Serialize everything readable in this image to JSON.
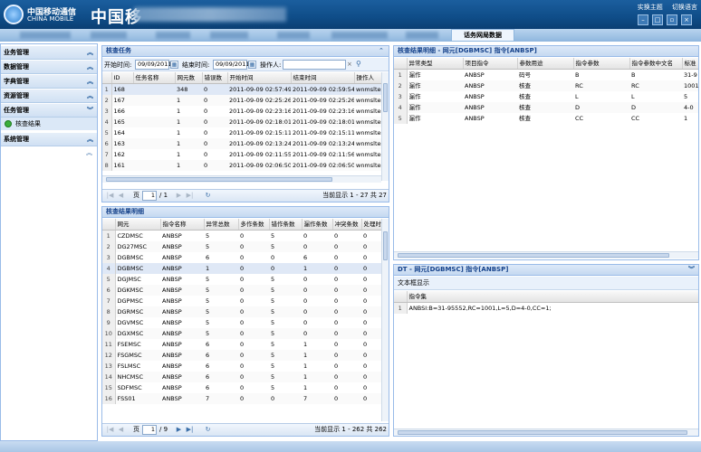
{
  "header": {
    "logo_cn": "中国移动通信",
    "logo_en": "CHINA MOBILE",
    "app_title": "中国移",
    "links": [
      "实换主题",
      "切换语言"
    ]
  },
  "nav": {
    "active_tab": "话务网局数据"
  },
  "sidebar": {
    "sections": [
      {
        "label": "业务管理"
      },
      {
        "label": "数据管理"
      },
      {
        "label": "字典管理"
      },
      {
        "label": "资源管理"
      },
      {
        "label": "任务管理"
      }
    ],
    "sub_item": "核查结果",
    "last_section": "系统管理"
  },
  "task_panel": {
    "title": "核查任务",
    "start_label": "开始时间:",
    "start_value": "09/09/2011",
    "end_label": "结束时间:",
    "end_value": "09/09/2011",
    "operator_label": "操作人:",
    "operator_value": "",
    "columns": [
      "",
      "ID",
      "任务名称",
      "网元数",
      "错误数",
      "开始时间",
      "结束时间",
      "操作人"
    ],
    "rows": [
      [
        "1",
        "168",
        "",
        "348",
        "0",
        "2011-09-09 02:57:49",
        "2011-09-09 02:59:54",
        "wnmsltes"
      ],
      [
        "2",
        "167",
        "",
        "1",
        "0",
        "2011-09-09 02:25:26",
        "2011-09-09 02:25:26",
        "wnmsltes"
      ],
      [
        "3",
        "166",
        "",
        "1",
        "0",
        "2011-09-09 02:23:16",
        "2011-09-09 02:23:16",
        "wnmsltes"
      ],
      [
        "4",
        "165",
        "",
        "1",
        "0",
        "2011-09-09 02:18:01",
        "2011-09-09 02:18:01",
        "wnmsltes"
      ],
      [
        "5",
        "164",
        "",
        "1",
        "0",
        "2011-09-09 02:15:11",
        "2011-09-09 02:15:11",
        "wnmsltes"
      ],
      [
        "6",
        "163",
        "",
        "1",
        "0",
        "2011-09-09 02:13:24",
        "2011-09-09 02:13:24",
        "wnmsltes"
      ],
      [
        "7",
        "162",
        "",
        "1",
        "0",
        "2011-09-09 02:11:55",
        "2011-09-09 02:11:56",
        "wnmsltes"
      ],
      [
        "8",
        "161",
        "",
        "1",
        "0",
        "2011-09-09 02:06:50",
        "2011-09-09 02:06:50",
        "wnmsltes"
      ]
    ],
    "pager": {
      "page_label": "页",
      "page": "1",
      "of": "/ 1",
      "info": "当前显示 1 - 27 共 27"
    }
  },
  "result_panel": {
    "title": "核查结果明细",
    "columns": [
      "",
      "网元",
      "指令名称",
      "异常总数",
      "多作条数",
      "错作条数",
      "漏作条数",
      "冲突条数",
      "处理时间"
    ],
    "rows": [
      [
        "1",
        "CZDMSC",
        "ANBSP",
        "5",
        "0",
        "5",
        "0",
        "0",
        "0"
      ],
      [
        "2",
        "DG27MSC",
        "ANBSP",
        "5",
        "0",
        "5",
        "0",
        "0",
        "0"
      ],
      [
        "3",
        "DGBMSC",
        "ANBSP",
        "6",
        "0",
        "0",
        "6",
        "0",
        "0"
      ],
      [
        "4",
        "DGBMSC",
        "ANBSP",
        "1",
        "0",
        "0",
        "1",
        "0",
        "0"
      ],
      [
        "5",
        "DGJMSC",
        "ANBSP",
        "5",
        "0",
        "5",
        "0",
        "0",
        "0"
      ],
      [
        "6",
        "DGKMSC",
        "ANBSP",
        "5",
        "0",
        "5",
        "0",
        "0",
        "0"
      ],
      [
        "7",
        "DGPMSC",
        "ANBSP",
        "5",
        "0",
        "5",
        "0",
        "0",
        "0"
      ],
      [
        "8",
        "DGRMSC",
        "ANBSP",
        "5",
        "0",
        "5",
        "0",
        "0",
        "0"
      ],
      [
        "9",
        "DGVMSC",
        "ANBSP",
        "5",
        "0",
        "5",
        "0",
        "0",
        "0"
      ],
      [
        "10",
        "DGXMSC",
        "ANBSP",
        "5",
        "0",
        "5",
        "0",
        "0",
        "0"
      ],
      [
        "11",
        "FSEMSC",
        "ANBSP",
        "6",
        "0",
        "5",
        "1",
        "0",
        "0"
      ],
      [
        "12",
        "FSGMSC",
        "ANBSP",
        "6",
        "0",
        "5",
        "1",
        "0",
        "0"
      ],
      [
        "13",
        "FSLMSC",
        "ANBSP",
        "6",
        "0",
        "5",
        "1",
        "0",
        "0"
      ],
      [
        "14",
        "NHCMSC",
        "ANBSP",
        "6",
        "0",
        "5",
        "1",
        "0",
        "0"
      ],
      [
        "15",
        "SDFMSC",
        "ANBSP",
        "6",
        "0",
        "5",
        "1",
        "0",
        "0"
      ],
      [
        "16",
        "FSS01",
        "ANBSP",
        "7",
        "0",
        "0",
        "7",
        "0",
        "0"
      ]
    ],
    "pager": {
      "page_label": "页",
      "page": "1",
      "of": "/ 9",
      "info": "当前显示 1 - 262 共 262"
    }
  },
  "detail_panel": {
    "title": "核查结果明细 - 网元[DGBMSC] 指令[ANBSP]",
    "columns": [
      "",
      "异常类型",
      "项目指令",
      "参数用途",
      "指令参数",
      "指令参数中文名",
      "标准"
    ],
    "rows": [
      [
        "1",
        "漏作",
        "ANBSP",
        "码号",
        "B",
        "B",
        "31-9"
      ],
      [
        "2",
        "漏作",
        "ANBSP",
        "核查",
        "RC",
        "RC",
        "1001"
      ],
      [
        "3",
        "漏作",
        "ANBSP",
        "核查",
        "L",
        "L",
        "5"
      ],
      [
        "4",
        "漏作",
        "ANBSP",
        "核查",
        "D",
        "D",
        "4-0"
      ],
      [
        "5",
        "漏作",
        "ANBSP",
        "核查",
        "CC",
        "CC",
        "1"
      ]
    ]
  },
  "dt_panel": {
    "title": "DT - 网元[DGBMSC] 指令[ANBSP]",
    "text_label": "文本框显示",
    "column": "指令集",
    "rows": [
      [
        "1",
        "ANBSI:B=31-95552,RC=1001,L=5,D=4-0,CC=1;"
      ]
    ]
  },
  "colors": {
    "header": "#0f4d88",
    "panel_border": "#99bbe8",
    "panel_title_text": "#15428b",
    "selected_row": "#dfe8f6"
  },
  "icons": [
    "globe-icon",
    "minimize-icon",
    "maximize-icon",
    "close-icon",
    "chevron-up-icon",
    "calendar-icon",
    "search-icon",
    "refresh-icon",
    "green-dot-icon"
  ]
}
